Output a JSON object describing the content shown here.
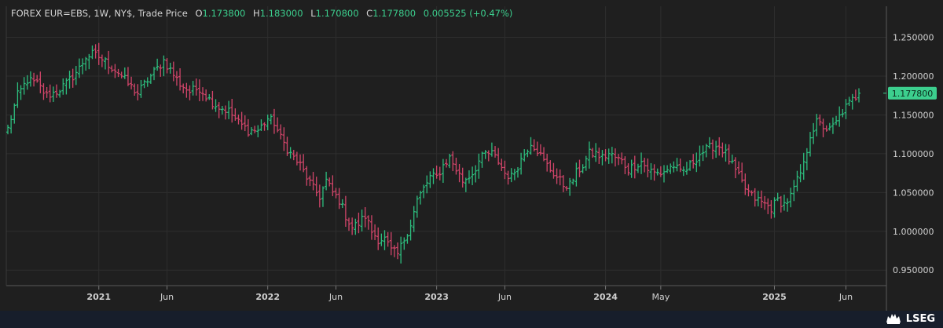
{
  "header": {
    "instrument": "FOREX EUR=EBS, 1W, NY$, Trade Price",
    "o_label": "O",
    "o_value": "1.173800",
    "h_label": "H",
    "h_value": "1.183000",
    "l_label": "L",
    "l_value": "1.170800",
    "c_label": "C",
    "c_value": "1.177800",
    "change": "0.005525 (+0.47%)"
  },
  "last_price_label": "1.177800",
  "brand": {
    "name": "LSEG",
    "logo_icon": "lion-crest-icon"
  },
  "colors": {
    "background": "#1f1f1f",
    "grid": "#2e2e2e",
    "up": "#2dbd7e",
    "down": "#d2456a",
    "text": "#d0d0d0",
    "price_tag": "#3ccf8e",
    "footer": "#171e2b"
  },
  "chart_data": {
    "type": "ohlc",
    "title": "",
    "interval": "weekly",
    "ylim": [
      0.93,
      1.29
    ],
    "y_ticks": [
      0.95,
      1.0,
      1.05,
      1.1,
      1.15,
      1.2,
      1.25
    ],
    "y_tick_labels": [
      "0.950000",
      "1.000000",
      "1.050000",
      "1.100000",
      "1.150000",
      "1.200000",
      "1.250000"
    ],
    "x_ticks": [
      {
        "label": "2021",
        "week": 28
      },
      {
        "label": "Jun",
        "week": 49
      },
      {
        "label": "2022",
        "week": 80
      },
      {
        "label": "Jun",
        "week": 101
      },
      {
        "label": "2023",
        "week": 132
      },
      {
        "label": "Jun",
        "week": 153
      },
      {
        "label": "2024",
        "week": 184
      },
      {
        "label": "May",
        "week": 201
      },
      {
        "label": "2025",
        "week": 236
      },
      {
        "label": "Jun",
        "week": 258
      }
    ],
    "grid": true,
    "week_count": 263,
    "anchors": [
      [
        0,
        1.132
      ],
      [
        3,
        1.175
      ],
      [
        6,
        1.195
      ],
      [
        9,
        1.19
      ],
      [
        12,
        1.175
      ],
      [
        15,
        1.18
      ],
      [
        18,
        1.19
      ],
      [
        22,
        1.21
      ],
      [
        24,
        1.225
      ],
      [
        26,
        1.228
      ],
      [
        28,
        1.225
      ],
      [
        31,
        1.215
      ],
      [
        34,
        1.205
      ],
      [
        37,
        1.19
      ],
      [
        40,
        1.178
      ],
      [
        43,
        1.195
      ],
      [
        46,
        1.21
      ],
      [
        48,
        1.22
      ],
      [
        50,
        1.208
      ],
      [
        53,
        1.19
      ],
      [
        56,
        1.18
      ],
      [
        59,
        1.185
      ],
      [
        62,
        1.17
      ],
      [
        65,
        1.16
      ],
      [
        68,
        1.155
      ],
      [
        71,
        1.14
      ],
      [
        74,
        1.13
      ],
      [
        77,
        1.13
      ],
      [
        80,
        1.145
      ],
      [
        82,
        1.14
      ],
      [
        84,
        1.12
      ],
      [
        87,
        1.1
      ],
      [
        90,
        1.085
      ],
      [
        92,
        1.07
      ],
      [
        94,
        1.055
      ],
      [
        96,
        1.045
      ],
      [
        98,
        1.065
      ],
      [
        100,
        1.05
      ],
      [
        102,
        1.04
      ],
      [
        104,
        1.02
      ],
      [
        106,
        1.005
      ],
      [
        108,
        1.01
      ],
      [
        110,
        1.02
      ],
      [
        112,
        1.0
      ],
      [
        114,
        0.99
      ],
      [
        116,
        0.99
      ],
      [
        118,
        0.975
      ],
      [
        120,
        0.97
      ],
      [
        122,
        0.99
      ],
      [
        124,
        1.01
      ],
      [
        126,
        1.04
      ],
      [
        128,
        1.055
      ],
      [
        130,
        1.07
      ],
      [
        132,
        1.07
      ],
      [
        134,
        1.085
      ],
      [
        136,
        1.095
      ],
      [
        138,
        1.08
      ],
      [
        140,
        1.065
      ],
      [
        143,
        1.075
      ],
      [
        145,
        1.09
      ],
      [
        147,
        1.1
      ],
      [
        149,
        1.1
      ],
      [
        151,
        1.09
      ],
      [
        153,
        1.075
      ],
      [
        155,
        1.07
      ],
      [
        157,
        1.085
      ],
      [
        159,
        1.1
      ],
      [
        161,
        1.115
      ],
      [
        163,
        1.105
      ],
      [
        165,
        1.09
      ],
      [
        167,
        1.08
      ],
      [
        169,
        1.07
      ],
      [
        171,
        1.06
      ],
      [
        173,
        1.06
      ],
      [
        175,
        1.075
      ],
      [
        177,
        1.085
      ],
      [
        179,
        1.1
      ],
      [
        181,
        1.1
      ],
      [
        183,
        1.095
      ],
      [
        185,
        1.1
      ],
      [
        187,
        1.095
      ],
      [
        189,
        1.09
      ],
      [
        191,
        1.08
      ],
      [
        193,
        1.085
      ],
      [
        195,
        1.09
      ],
      [
        197,
        1.08
      ],
      [
        199,
        1.075
      ],
      [
        201,
        1.075
      ],
      [
        203,
        1.08
      ],
      [
        205,
        1.085
      ],
      [
        207,
        1.075
      ],
      [
        209,
        1.08
      ],
      [
        211,
        1.09
      ],
      [
        213,
        1.1
      ],
      [
        215,
        1.105
      ],
      [
        217,
        1.11
      ],
      [
        219,
        1.11
      ],
      [
        221,
        1.1
      ],
      [
        223,
        1.085
      ],
      [
        225,
        1.07
      ],
      [
        227,
        1.055
      ],
      [
        229,
        1.045
      ],
      [
        231,
        1.04
      ],
      [
        233,
        1.035
      ],
      [
        235,
        1.03
      ],
      [
        237,
        1.04
      ],
      [
        239,
        1.035
      ],
      [
        241,
        1.045
      ],
      [
        243,
        1.065
      ],
      [
        245,
        1.085
      ],
      [
        247,
        1.125
      ],
      [
        249,
        1.14
      ],
      [
        251,
        1.135
      ],
      [
        253,
        1.13
      ],
      [
        255,
        1.14
      ],
      [
        257,
        1.155
      ],
      [
        259,
        1.165
      ],
      [
        262,
        1.178
      ]
    ]
  }
}
